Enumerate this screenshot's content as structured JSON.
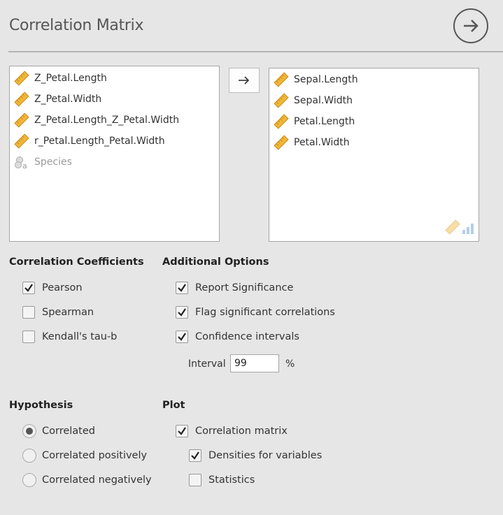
{
  "header": {
    "title": "Correlation Matrix",
    "nav_icon": "arrow-right-circle-icon"
  },
  "source_vars": [
    {
      "label": "Z_Petal.Length",
      "type": "continuous",
      "enabled": true
    },
    {
      "label": "Z_Petal.Width",
      "type": "continuous",
      "enabled": true
    },
    {
      "label": "Z_Petal.Length_Z_Petal.Width",
      "type": "continuous",
      "enabled": true
    },
    {
      "label": "r_Petal.Length_Petal.Width",
      "type": "continuous",
      "enabled": true
    },
    {
      "label": "Species",
      "type": "nominal-text",
      "enabled": false
    }
  ],
  "target_vars": [
    {
      "label": "Sepal.Length",
      "type": "continuous"
    },
    {
      "label": "Sepal.Width",
      "type": "continuous"
    },
    {
      "label": "Petal.Length",
      "type": "continuous"
    },
    {
      "label": "Petal.Width",
      "type": "continuous"
    }
  ],
  "move_button": {
    "icon": "arrow-right-icon"
  },
  "coefficients": {
    "heading": "Correlation Coefficients",
    "options": [
      {
        "label": "Pearson",
        "checked": true
      },
      {
        "label": "Spearman",
        "checked": false
      },
      {
        "label": "Kendall's tau-b",
        "checked": false
      }
    ]
  },
  "additional": {
    "heading": "Additional Options",
    "options": [
      {
        "label": "Report Significance",
        "checked": true
      },
      {
        "label": "Flag significant correlations",
        "checked": true
      },
      {
        "label": "Confidence intervals",
        "checked": true
      }
    ],
    "interval_label": "Interval",
    "interval_value": "99",
    "interval_suffix": "%"
  },
  "hypothesis": {
    "heading": "Hypothesis",
    "options": [
      {
        "label": "Correlated",
        "selected": true
      },
      {
        "label": "Correlated positively",
        "selected": false
      },
      {
        "label": "Correlated negatively",
        "selected": false
      }
    ]
  },
  "plot": {
    "heading": "Plot",
    "options": [
      {
        "label": "Correlation matrix",
        "checked": true
      },
      {
        "label": "Densities for variables",
        "checked": true
      },
      {
        "label": "Statistics",
        "checked": false
      }
    ]
  },
  "colors": {
    "ruler": "#f0b63a",
    "ruler_dark": "#c98a12",
    "background": "#e6e6e6"
  }
}
